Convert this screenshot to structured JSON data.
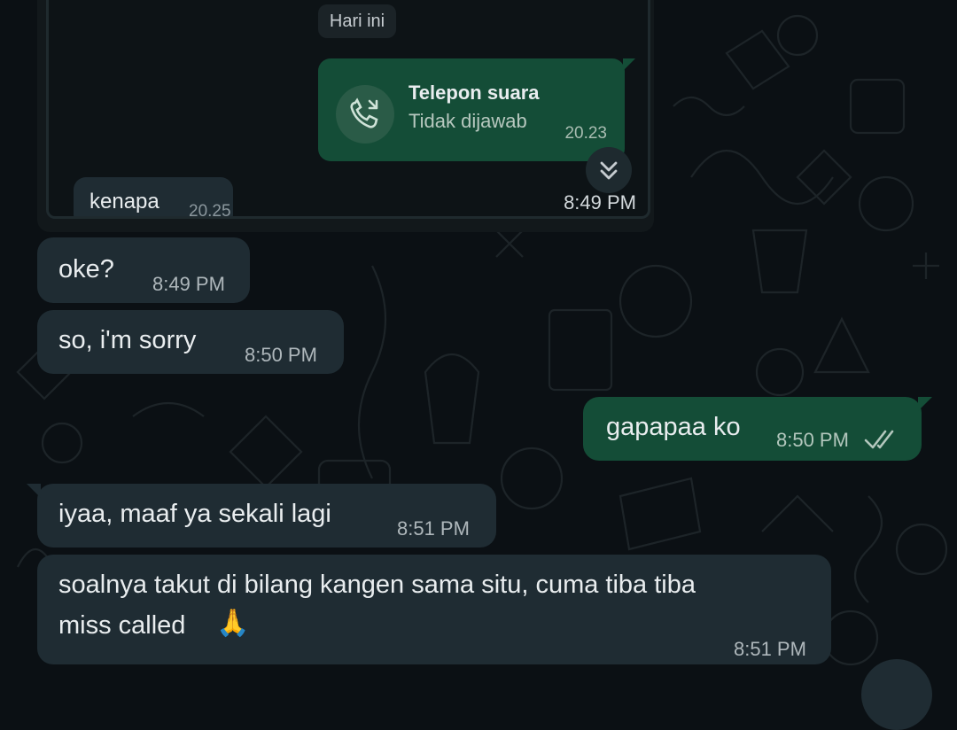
{
  "quoted_screenshot": {
    "day_chip": "Hari ini",
    "call_card": {
      "title": "Telepon suara",
      "status": "Tidak dijawab",
      "time": "20.23"
    },
    "incoming_message": {
      "text": "kenapa",
      "time": "20.25"
    },
    "sent_time": "8:49 PM"
  },
  "messages": [
    {
      "direction": "in",
      "text": "oke?",
      "time": "8:49 PM"
    },
    {
      "direction": "in",
      "text": "so, i'm sorry",
      "time": "8:50 PM"
    },
    {
      "direction": "out",
      "text": "gapapaa ko",
      "time": "8:50 PM",
      "status": "read"
    },
    {
      "direction": "in",
      "text": "iyaa, maaf ya sekali lagi",
      "time": "8:51 PM"
    },
    {
      "direction": "in",
      "text_line1": "soalnya takut di bilang kangen sama situ, cuma tiba tiba",
      "text_line2": "miss called",
      "emoji": "🙏",
      "time": "8:51 PM"
    }
  ],
  "colors": {
    "background": "#0b1014",
    "incoming_bubble": "#1f2c33",
    "outgoing_bubble": "#144d37",
    "read_ticks": "#b3c7bd"
  },
  "icons": {
    "call": "missed-voice-call-icon",
    "scroll": "double-chevron-down-icon",
    "read_receipt": "double-check-icon"
  }
}
